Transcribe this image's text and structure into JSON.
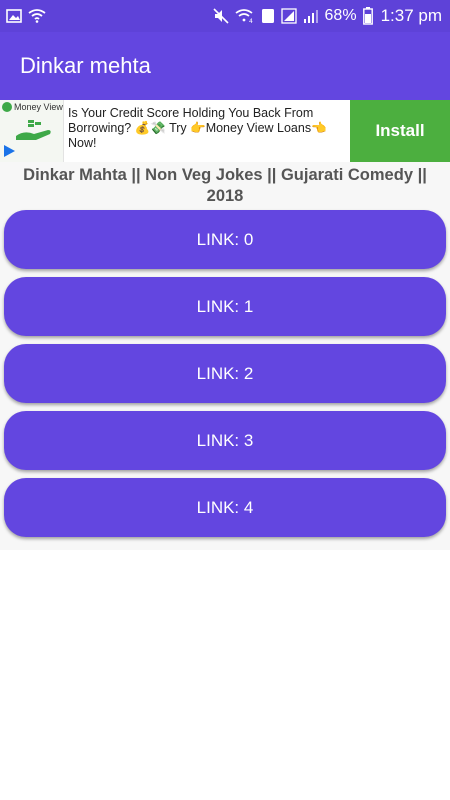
{
  "status_bar": {
    "battery_percent": "68%",
    "time": "1:37 pm",
    "sim_label": "1",
    "icons": [
      "image-icon",
      "wifi-icon",
      "mute-icon",
      "wifi-calling-icon",
      "sim-icon",
      "signal-icon",
      "battery-icon"
    ]
  },
  "app_bar": {
    "title": "Dinkar mehta",
    "color": "#6346e0"
  },
  "ad": {
    "brand": "Money View",
    "text": "Is Your Credit Score Holding You Back From Borrowing? 💰💸 Try 👉Money View Loans👈 Now!",
    "install_label": "Install",
    "install_color": "#4caf3f"
  },
  "main": {
    "video_title": "Dinkar Mahta || Non Veg Jokes || Gujarati Comedy || 2018",
    "links": [
      {
        "label": "LINK: 0"
      },
      {
        "label": "LINK: 1"
      },
      {
        "label": "LINK: 2"
      },
      {
        "label": "LINK: 3"
      },
      {
        "label": "LINK: 4"
      }
    ],
    "button_color": "#6346e0"
  }
}
